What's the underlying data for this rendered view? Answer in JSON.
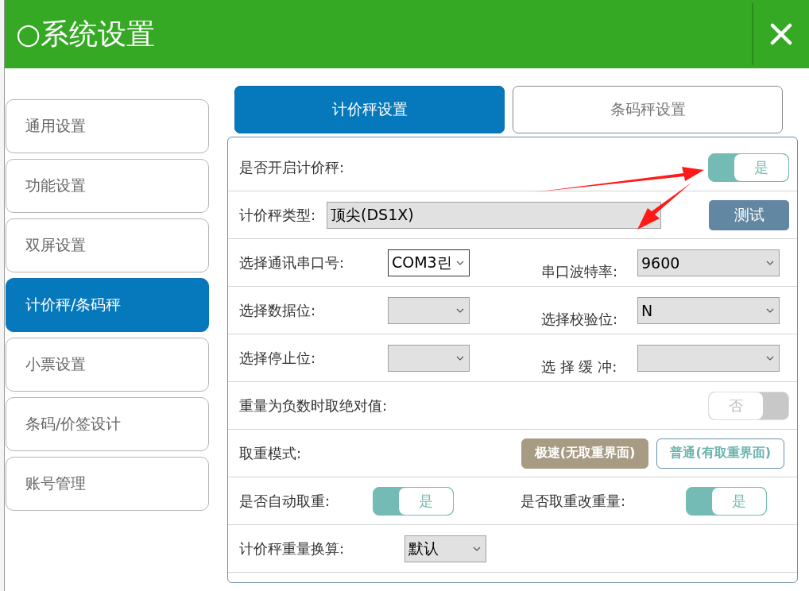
{
  "window": {
    "title": "○系统设置"
  },
  "sidebar": {
    "items": [
      {
        "label": "通用设置",
        "selected": false
      },
      {
        "label": "功能设置",
        "selected": false
      },
      {
        "label": "双屏设置",
        "selected": false
      },
      {
        "label": "计价秤/条码秤",
        "selected": true
      },
      {
        "label": "小票设置",
        "selected": false
      },
      {
        "label": "条码/价签设计",
        "selected": false
      },
      {
        "label": "账号管理",
        "selected": false
      }
    ]
  },
  "tabs": [
    {
      "label": "计价秤设置",
      "selected": true
    },
    {
      "label": "条码秤设置",
      "selected": false
    }
  ],
  "rows": [
    {
      "kind": "toggle",
      "label": "是否开启计价秤:",
      "toggle": {
        "on": true,
        "text": "是"
      }
    },
    {
      "kind": "select_button",
      "label": "计价秤类型:",
      "select": {
        "value": "顶尖(DS1X)"
      },
      "button": "测试"
    },
    {
      "kind": "pair",
      "fields": [
        {
          "label": "选择通讯串口号:",
          "select": {
            "value": "COM3린",
            "focused": true
          }
        },
        {
          "label": "串口波特率:",
          "select": {
            "value": "9600",
            "focused": false
          }
        }
      ]
    },
    {
      "kind": "pair",
      "fields": [
        {
          "label": "选择数据位:",
          "select": {
            "focused": false
          }
        },
        {
          "label": "选择校验位:",
          "select": {
            "value": "N",
            "focused": false
          }
        }
      ]
    },
    {
      "kind": "pair",
      "fields": [
        {
          "label": "选择停止位:",
          "select": {
            "focused": false
          }
        },
        {
          "label": "选 择 缓 冲:",
          "select": {
            "focused": false
          }
        }
      ]
    },
    {
      "kind": "toggle",
      "label": "重量为负数时取绝对值:",
      "toggle": {
        "on": false,
        "text": "否"
      }
    },
    {
      "kind": "options",
      "label": "取重模式:",
      "options": [
        {
          "label": "极速(无取重界面)",
          "selected": true
        },
        {
          "label": "普通(有取重界面)",
          "selected": false
        }
      ]
    },
    {
      "kind": "toggle_pair",
      "fields": [
        {
          "label": "是否自动取重:",
          "toggle": {
            "on": true,
            "text": "是"
          }
        },
        {
          "label": "是否取重改重量:",
          "toggle": {
            "on": true,
            "text": "是"
          }
        }
      ]
    },
    {
      "kind": "select",
      "label": "计价秤重量换算:",
      "select": {
        "value": "默认"
      }
    }
  ]
}
